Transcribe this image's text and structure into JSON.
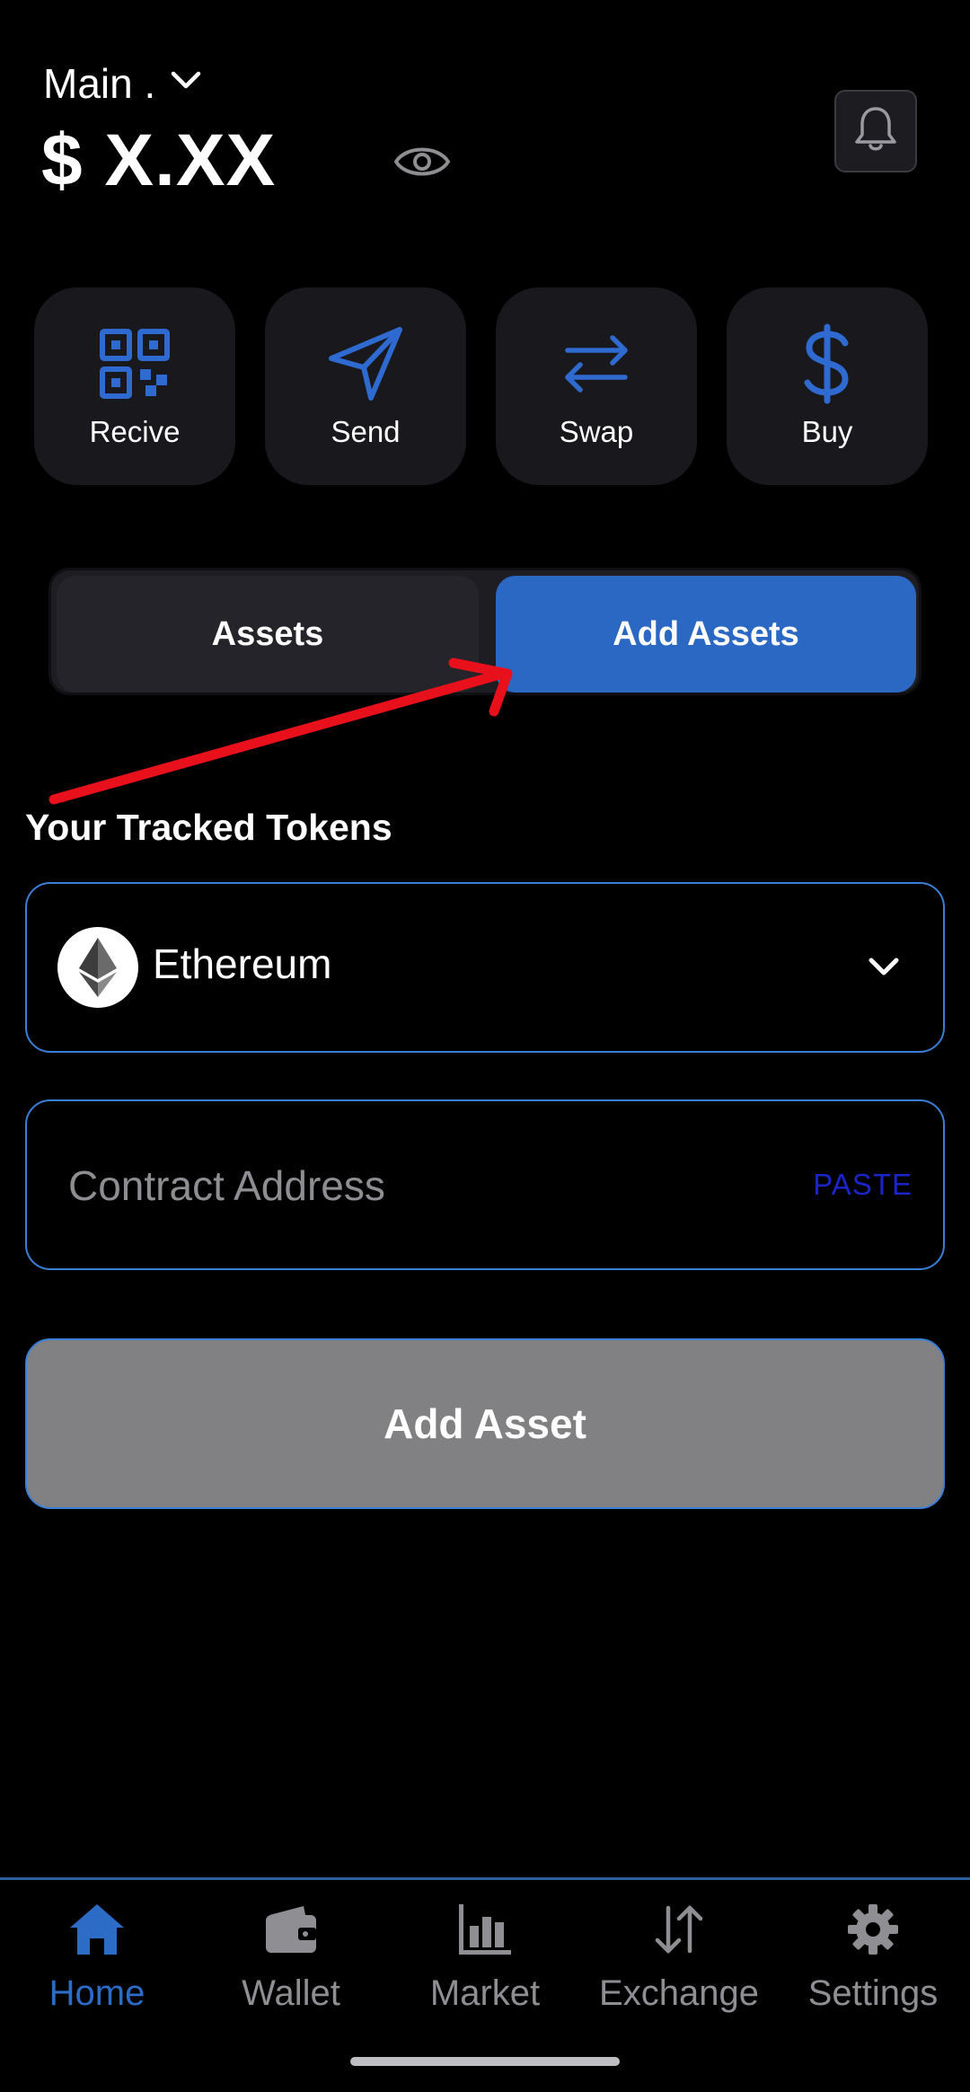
{
  "header": {
    "wallet_name": "Main .",
    "balance": "$ X.XX"
  },
  "actions": [
    {
      "label": "Recive",
      "icon": "qr-code-icon"
    },
    {
      "label": "Send",
      "icon": "send-icon"
    },
    {
      "label": "Swap",
      "icon": "swap-icon"
    },
    {
      "label": "Buy",
      "icon": "dollar-icon"
    }
  ],
  "tabs": [
    {
      "label": "Assets",
      "active": false
    },
    {
      "label": "Add Assets",
      "active": true
    }
  ],
  "section": {
    "title": "Your Tracked Tokens"
  },
  "token_select": {
    "value": "Ethereum",
    "icon": "ethereum-icon"
  },
  "contract": {
    "placeholder": "Contract Address",
    "value": "",
    "paste_label": "PASTE"
  },
  "add_asset_label": "Add Asset",
  "nav": [
    {
      "label": "Home",
      "icon": "home-icon",
      "active": true
    },
    {
      "label": "Wallet",
      "icon": "wallet-icon",
      "active": false
    },
    {
      "label": "Market",
      "icon": "market-icon",
      "active": false
    },
    {
      "label": "Exchange",
      "icon": "exchange-icon",
      "active": false
    },
    {
      "label": "Settings",
      "icon": "gear-icon",
      "active": false
    }
  ],
  "colors": {
    "accent": "#2b68c4",
    "nav_active": "#2c6bc6",
    "nav_inactive": "#8e8e93",
    "paste": "#1a24c9",
    "annotation_arrow": "#e8101a",
    "field_border": "#3a7fd6"
  }
}
